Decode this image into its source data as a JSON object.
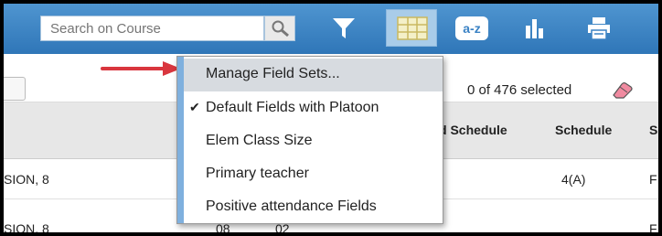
{
  "toolbar": {
    "search_placeholder": "Search on Course",
    "icons": [
      "search-icon",
      "filter-icon",
      "grid-icon",
      "sort-az-icon",
      "chart-icon",
      "print-icon"
    ],
    "sort_label": "a-z",
    "accent": "#3a82c4"
  },
  "subrow": {
    "selection_text": "0 of 476 selected"
  },
  "columns": {
    "col_sched_partial": "d Schedule",
    "col_schedule": "Schedule",
    "col_partial_s": "S"
  },
  "rows": [
    {
      "name": "SION, 8",
      "schedule": "4(A)",
      "tail": "F"
    },
    {
      "name": "SION, 8",
      "mid1": "08",
      "mid2": "02",
      "tail": "F"
    }
  ],
  "menu": {
    "items": [
      {
        "label": "Manage Field Sets...",
        "checked": false,
        "hover": true
      },
      {
        "label": "Default Fields with Platoon",
        "checked": true,
        "hover": false
      },
      {
        "label": "Elem Class Size",
        "checked": false,
        "hover": false
      },
      {
        "label": "Primary teacher",
        "checked": false,
        "hover": false
      },
      {
        "label": "Positive attendance Fields",
        "checked": false,
        "hover": false
      }
    ],
    "check_glyph": "✔"
  },
  "annotation_color": "#d9363e"
}
